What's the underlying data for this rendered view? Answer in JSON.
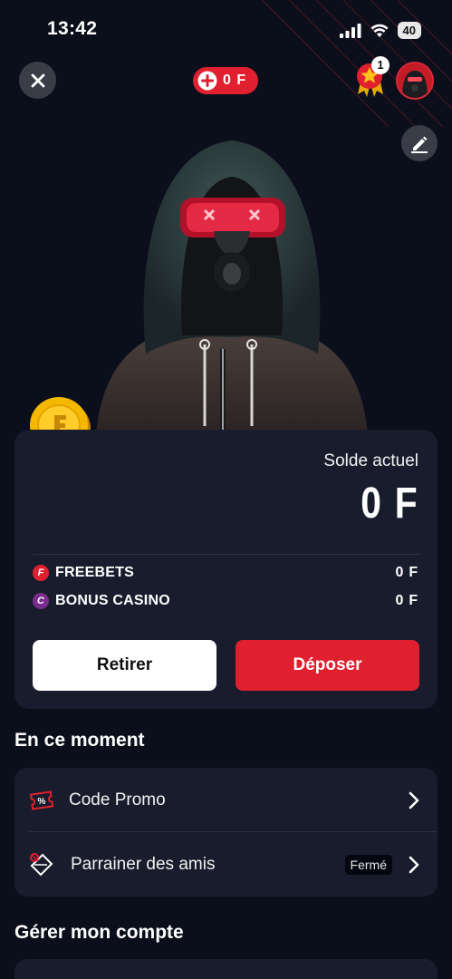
{
  "status_bar": {
    "time": "13:42",
    "battery": "40"
  },
  "header": {
    "balance_pill": "0 F",
    "reward_count": "1"
  },
  "balance": {
    "label": "Solde actuel",
    "value": "0 F",
    "rows": [
      {
        "icon_letter": "F",
        "label": "FREEBETS",
        "amount": "0 F",
        "color": "#e0202e"
      },
      {
        "icon_letter": "C",
        "label": "BONUS CASINO",
        "amount": "0 F",
        "color": "#7a2d8c"
      }
    ],
    "withdraw_label": "Retirer",
    "deposit_label": "Déposer"
  },
  "moment": {
    "title": "En ce moment",
    "items": [
      {
        "label": "Code Promo",
        "icon": "promo-ticket-icon"
      },
      {
        "label": "Parrainer des amis",
        "icon": "referral-icon",
        "badge": "Fermé"
      }
    ]
  },
  "account": {
    "title": "Gérer mon compte"
  },
  "colors": {
    "accent": "#e0202e",
    "background": "#0b0e1b",
    "card": "#191c2c",
    "coin": "#f5b800"
  }
}
